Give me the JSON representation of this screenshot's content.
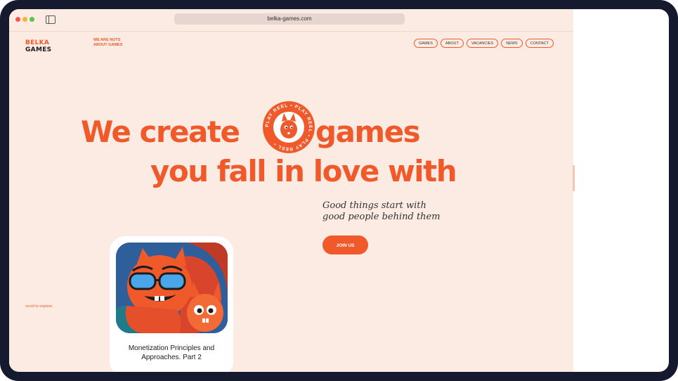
{
  "browser": {
    "url": "belka-games.com"
  },
  "header": {
    "logo_line1": "BELKA",
    "logo_line2": "GAMES",
    "tagline_line1": "WE ARE NUTS",
    "tagline_line2": "ABOUT GAMES",
    "nav": [
      "GAMES",
      "ABOUT",
      "VACANCIES",
      "NEWS",
      "CONTACT"
    ]
  },
  "hero": {
    "line1_part1": "We create",
    "line1_part2": "games",
    "line2": "you fall in love with",
    "play_reel_text": "PLAY REEL • PLAY REEL • PLAY REEL •",
    "subtitle_line1": "Good things start with",
    "subtitle_line2": "good people behind them",
    "cta": "JOIN US"
  },
  "scroll_hint": "scroll to explore",
  "card": {
    "title_line1": "Monetization Principles and",
    "title_line2": "Approaches. Part 2"
  },
  "colors": {
    "accent": "#f05a2a",
    "background": "#fcebe3",
    "frame": "#161a2e"
  },
  "icons": {
    "sidebar_toggle": "sidebar-toggle-icon",
    "play_reel": "play-reel-badge-icon"
  }
}
